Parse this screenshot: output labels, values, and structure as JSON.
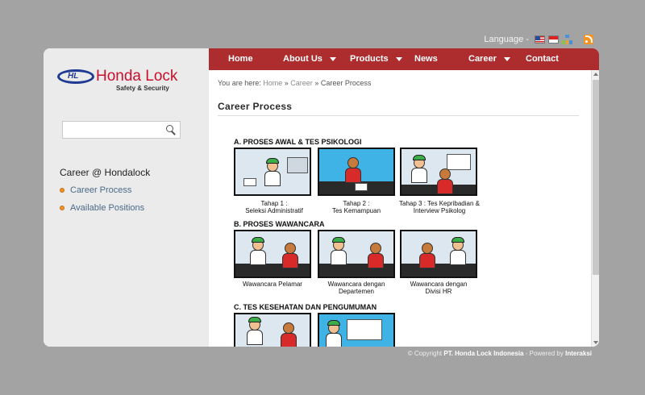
{
  "language": {
    "label": "Language -",
    "icons": [
      "flag-us-icon",
      "flag-id-icon",
      "sitemap-icon",
      "rss-icon"
    ]
  },
  "logo": {
    "mark": "HL",
    "name": "Honda Lock",
    "tagline": "Safety & Security"
  },
  "search": {
    "placeholder": "",
    "value": ""
  },
  "sidebar": {
    "heading": "Career @ Hondalock",
    "items": [
      {
        "label": "Career Process"
      },
      {
        "label": "Available Positions"
      }
    ]
  },
  "nav": {
    "items": [
      {
        "label": "Home",
        "dropdown": false
      },
      {
        "label": "About Us",
        "dropdown": true
      },
      {
        "label": "Products",
        "dropdown": true
      },
      {
        "label": "News",
        "dropdown": false
      },
      {
        "label": "Career",
        "dropdown": true
      },
      {
        "label": "Contact",
        "dropdown": false
      }
    ]
  },
  "breadcrumb": {
    "prefix": "You are here:",
    "home": "Home",
    "sep": "»",
    "career": "Career",
    "current": "Career Process"
  },
  "page": {
    "title": "Career Process"
  },
  "process": {
    "sections": [
      {
        "heading": "A. PROSES AWAL & TES PSIKOLOGI",
        "steps": [
          {
            "caption1": "Tahap 1 :",
            "caption2": "Seleksi Administratif"
          },
          {
            "caption1": "Tahap 2 :",
            "caption2": "Tes Kemampuan"
          },
          {
            "caption1": "Tahap 3 : Tes Kepribadian &",
            "caption2": "Interview Psikolog"
          }
        ]
      },
      {
        "heading": "B. PROSES WAWANCARA",
        "steps": [
          {
            "caption1": "Wawancara Pelamar",
            "caption2": ""
          },
          {
            "caption1": "Wawancara dengan",
            "caption2": "Departemen"
          },
          {
            "caption1": "Wawancara dengan",
            "caption2": "Divisi HR"
          }
        ]
      },
      {
        "heading": "C. TES KESEHATAN DAN PENGUMUMAN",
        "steps": []
      }
    ],
    "hat_text": "HLI"
  },
  "footer": {
    "prefix": "© Copyright",
    "company": "PT. Honda Lock Indonesia",
    "mid": "- Powered by",
    "powered": "Interaksi"
  },
  "colors": {
    "nav": "#ad2d2f",
    "brand_red": "#c8102e",
    "brand_blue": "#1f3a93",
    "bullet": "#f39321",
    "link": "#4a6a8a"
  }
}
